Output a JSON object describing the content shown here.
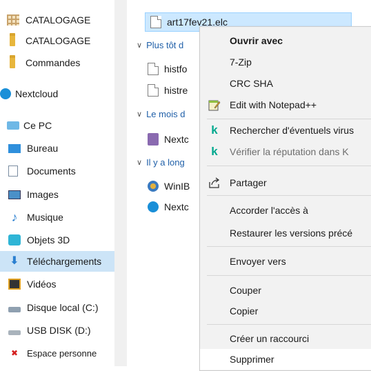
{
  "nav": {
    "items": [
      {
        "label": "CATALOGAGE",
        "icon": "grid-folder-icon"
      },
      {
        "label": "CATALOGAGE",
        "icon": "folder-icon"
      },
      {
        "label": "Commandes",
        "icon": "folder-icon"
      },
      {
        "label": "Nextcloud",
        "icon": "nextcloud-icon"
      },
      {
        "label": "Ce PC",
        "icon": "computer-icon"
      },
      {
        "label": "Bureau",
        "icon": "desktop-icon"
      },
      {
        "label": "Documents",
        "icon": "documents-icon"
      },
      {
        "label": "Images",
        "icon": "pictures-icon"
      },
      {
        "label": "Musique",
        "icon": "music-icon"
      },
      {
        "label": "Objets 3D",
        "icon": "objects-3d-icon"
      },
      {
        "label": "Téléchargements",
        "icon": "download-icon",
        "selected": true
      },
      {
        "label": "Vidéos",
        "icon": "videos-icon"
      },
      {
        "label": "Disque local (C:)",
        "icon": "local-disk-icon"
      },
      {
        "label": "USB DISK (D:)",
        "icon": "usb-drive-icon"
      },
      {
        "label": "Espace personne",
        "icon": "network-drive-icon"
      }
    ]
  },
  "files": {
    "selected_file": "art17fev21.elc",
    "groups": [
      {
        "label": "Plus tôt d",
        "items": [
          "histfo",
          "histre"
        ]
      },
      {
        "label": "Le mois d",
        "items": [
          "Nextc"
        ]
      },
      {
        "label": "Il y a long",
        "items": [
          "WinIB",
          "Nextc"
        ]
      }
    ]
  },
  "context_menu": {
    "items": [
      {
        "label": "Ouvrir avec",
        "bold": true
      },
      {
        "label": "7-Zip"
      },
      {
        "label": "CRC SHA"
      },
      {
        "label": "Edit with Notepad++",
        "icon": "notepad-plus-plus-icon"
      },
      {
        "label": "Rechercher d'éventuels virus",
        "icon": "kaspersky-icon"
      },
      {
        "label": "Vérifier la réputation dans K",
        "icon": "kaspersky-icon",
        "disabled": true
      },
      {
        "label": "Partager",
        "icon": "share-icon"
      },
      {
        "label": "Accorder l'accès à"
      },
      {
        "label": "Restaurer les versions précé"
      },
      {
        "label": "Envoyer vers"
      },
      {
        "label": "Couper"
      },
      {
        "label": "Copier"
      },
      {
        "label": "Créer un raccourci",
        "hover": true
      },
      {
        "label": "Supprimer"
      }
    ]
  },
  "colors": {
    "selection": "#cce4f7",
    "group_header": "#1f5fa8",
    "kaspersky_green": "#00a88e",
    "menu_background": "#f2f2f2"
  }
}
